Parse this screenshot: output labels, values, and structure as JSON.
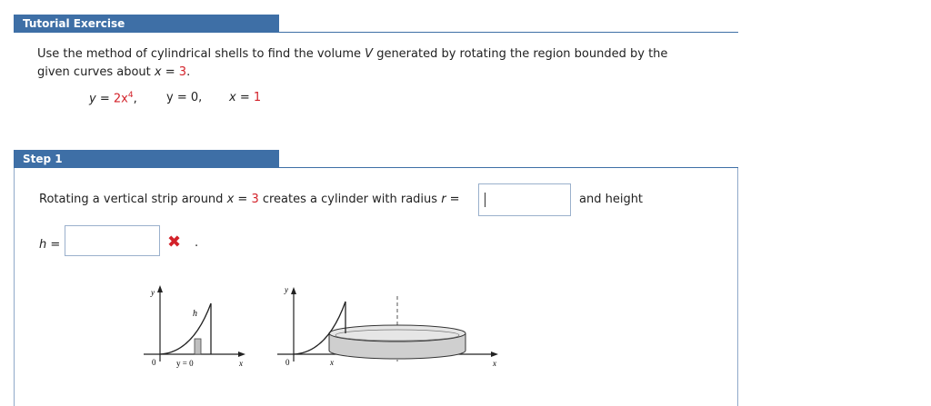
{
  "tutorial": {
    "header": "Tutorial Exercise",
    "problem_line1_prefix": "Use the method of cylindrical shells to find the volume ",
    "problem_var_V": "V",
    "problem_line1_suffix": " generated by rotating the region bounded by the",
    "problem_line2_prefix": "given curves about ",
    "problem_x": "x",
    "problem_eq": " = ",
    "problem_axis_value": "3",
    "problem_period": ".",
    "curves": {
      "c1_var": "y",
      "c1_eq": " = ",
      "c1_coef": "2x",
      "c1_exp": "4",
      "c1_comma": ",",
      "c2": "y = 0,",
      "c3_var": "x",
      "c3_eq": " = ",
      "c3_val": "1"
    }
  },
  "step1": {
    "header": "Step 1",
    "sentence_prefix": "Rotating a vertical strip around ",
    "sentence_x": "x",
    "sentence_eq": " = ",
    "sentence_val": "3",
    "sentence_mid": " creates a cylinder with radius ",
    "sentence_r": "r",
    "sentence_r_eq": " =",
    "and_height": "and height",
    "h_var": "h",
    "h_eq": " =",
    "radius_value": "",
    "height_value": "",
    "period": ".",
    "figure_left": {
      "y_label": "y",
      "h_label": "h",
      "zero_label": "0",
      "y0_label": "y = 0",
      "x_label": "x"
    },
    "figure_right": {
      "y_label": "y",
      "zero_label": "0",
      "x_label_mid": "x",
      "x_label_end": "x"
    }
  }
}
